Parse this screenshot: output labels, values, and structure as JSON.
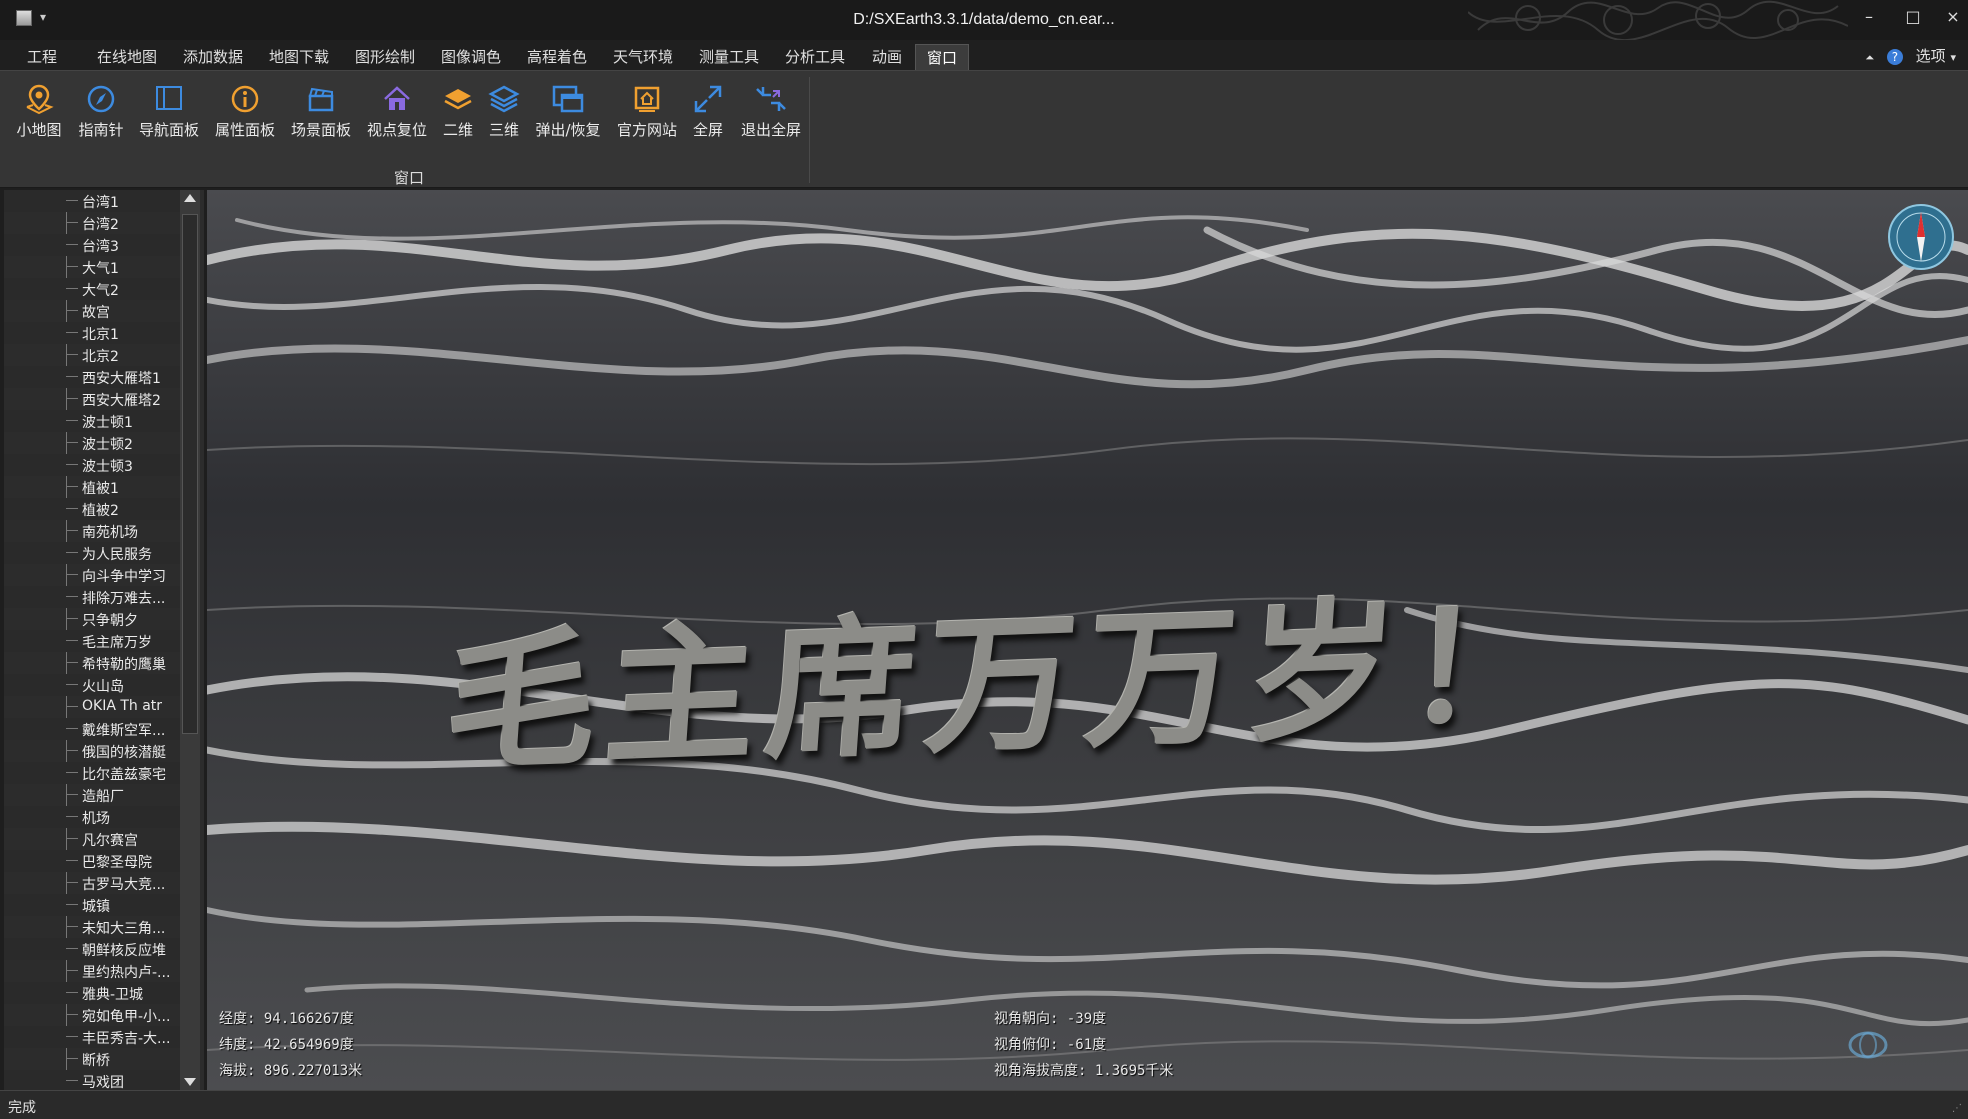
{
  "window": {
    "title": "D:/SXEarth3.3.1/data/demo_cn.ear...",
    "quick_access": "▾",
    "minimize_label": "–",
    "maximize_label": "□",
    "close_label": "×"
  },
  "menu": {
    "tabs": [
      "工程",
      "在线地图",
      "添加数据",
      "地图下载",
      "图形绘制",
      "图像调色",
      "高程着色",
      "天气环境",
      "测量工具",
      "分析工具",
      "动画",
      "窗口"
    ],
    "active_tab": "窗口",
    "options_label": "选项",
    "options_arrow": "▾",
    "help_icon_text": "?",
    "collapse_icon_text": "⏶"
  },
  "ribbon": {
    "group_label": "窗口",
    "buttons": [
      {
        "label": "小地图",
        "icon": "map-pin-icon",
        "color": "#f0a030"
      },
      {
        "label": "指南针",
        "icon": "compass-icon",
        "color": "#3d8be0"
      },
      {
        "label": "导航面板",
        "icon": "panel-icon",
        "color": "#3d8be0"
      },
      {
        "label": "属性面板",
        "icon": "info-icon",
        "color": "#f0a030"
      },
      {
        "label": "场景面板",
        "icon": "clapper-icon",
        "color": "#3d8be0"
      },
      {
        "label": "视点复位",
        "icon": "home-icon",
        "color": "#8a6ae0"
      },
      {
        "label": "二维",
        "icon": "layer-2d-icon",
        "color": "#f0a030"
      },
      {
        "label": "三维",
        "icon": "layers-3d-icon",
        "color": "#3d8be0"
      },
      {
        "label": "弹出/恢复",
        "icon": "popup-window-icon",
        "color": "#3d8be0"
      },
      {
        "label": "官方网站",
        "icon": "website-home-icon",
        "color": "#f0a030"
      },
      {
        "label": "全屏",
        "icon": "fullscreen-icon",
        "color": "#3d8be0"
      },
      {
        "label": "退出全屏",
        "icon": "exit-fullscreen-icon",
        "color": "#3d8be0"
      }
    ]
  },
  "tree": {
    "items": [
      "台湾1",
      "台湾2",
      "台湾3",
      "大气1",
      "大气2",
      "故宫",
      "北京1",
      "北京2",
      "西安大雁塔1",
      "西安大雁塔2",
      "波士顿1",
      "波士顿2",
      "波士顿3",
      "植被1",
      "植被2",
      "南苑机场",
      "为人民服务",
      "向斗争中学习",
      "排除万难去...",
      "只争朝夕",
      "毛主席万岁",
      "希特勒的鹰巢",
      "火山岛",
      "OKIA Th atr",
      "戴维斯空军...",
      "俄国的核潜艇",
      "比尔盖兹豪宅",
      "造船厂",
      "机场",
      "凡尔赛宫",
      "巴黎圣母院",
      "古罗马大竞...",
      "城镇",
      "未知大三角...",
      "朝鲜核反应堆",
      "里约热内卢-...",
      "雅典-卫城",
      "宛如龟甲-小...",
      "丰臣秀吉-大...",
      "断桥",
      "马戏团"
    ]
  },
  "map": {
    "ground_text": "毛主席万万岁！",
    "longitude": "经度: 94.166267度",
    "latitude": "纬度: 42.654969度",
    "altitude": "海拔: 896.227013米",
    "heading": "视角朝向:     -39度",
    "pitch": "视角俯仰:     -61度",
    "view_altitude": "视角海拔高度: 1.3695千米",
    "compass_icon": "compass-rose-icon",
    "logo_icon": "globe-logo-icon"
  },
  "status": {
    "text": "完成",
    "grip": "⋰"
  }
}
